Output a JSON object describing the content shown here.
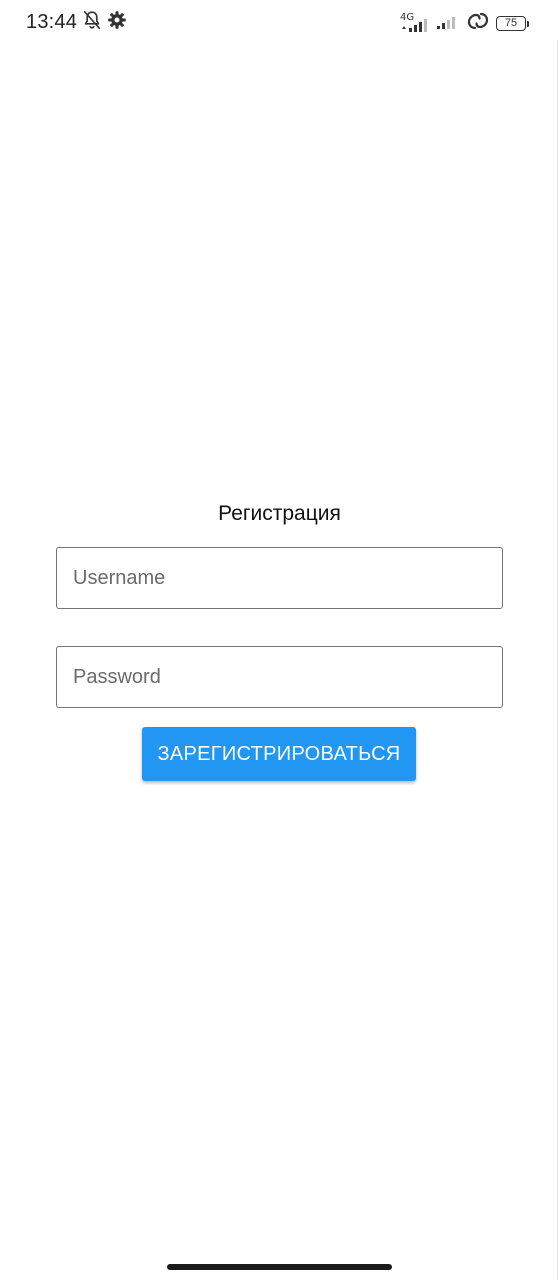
{
  "status_bar": {
    "time": "13:44",
    "icons": [
      "bell-off-icon",
      "gear-icon",
      "signal-icon",
      "signal-icon",
      "sync-icon",
      "battery-icon"
    ],
    "network_type": "4G",
    "battery_level": "75"
  },
  "form": {
    "title": "Регистрация",
    "username_placeholder": "Username",
    "username_value": "",
    "password_placeholder": "Password",
    "password_value": "",
    "submit_label": "ЗАРЕГИСТРИРОВАТЬСЯ"
  },
  "colors": {
    "accent": "#2196f3",
    "field_border": "#757575",
    "background": "#ffffff"
  }
}
